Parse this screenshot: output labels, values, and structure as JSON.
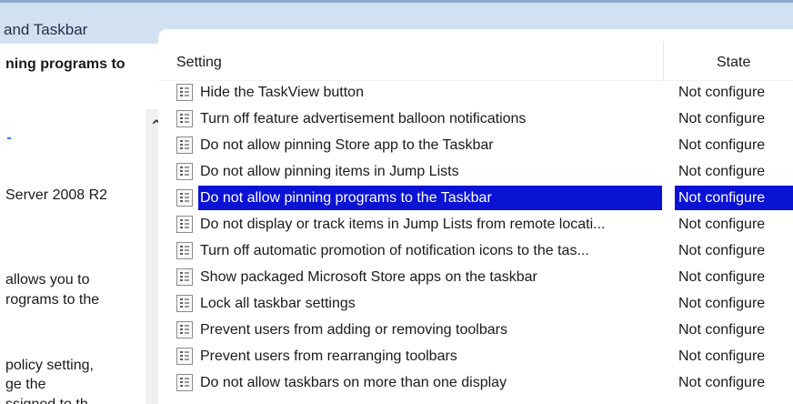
{
  "window": {
    "title": "and Taskbar"
  },
  "left_panel": {
    "heading": "ning programs to",
    "requirements": "Server 2008 R2",
    "description_lines": [
      "allows you to",
      "rograms to the",
      "policy setting,",
      "ge the",
      "ssigned to th"
    ]
  },
  "columns": {
    "setting": "Setting",
    "state": "State"
  },
  "rows": [
    {
      "name": "Hide the TaskView button",
      "state": "Not configure"
    },
    {
      "name": "Turn off feature advertisement balloon notifications",
      "state": "Not configure"
    },
    {
      "name": "Do not allow pinning Store app to the Taskbar",
      "state": "Not configure"
    },
    {
      "name": "Do not allow pinning items in Jump Lists",
      "state": "Not configure"
    },
    {
      "name": "Do not allow pinning programs to the Taskbar",
      "state": "Not configure",
      "selected": true
    },
    {
      "name": "Do not display or track items in Jump Lists from remote locati...",
      "state": "Not configure"
    },
    {
      "name": "Turn off automatic promotion of notification icons to the tas...",
      "state": "Not configure"
    },
    {
      "name": "Show packaged Microsoft Store apps on the taskbar",
      "state": "Not configure"
    },
    {
      "name": "Lock all taskbar settings",
      "state": "Not configure"
    },
    {
      "name": "Prevent users from adding or removing toolbars",
      "state": "Not configure"
    },
    {
      "name": "Prevent users from rearranging toolbars",
      "state": "Not configure"
    },
    {
      "name": "Do not allow taskbars on more than one display",
      "state": "Not configure"
    }
  ],
  "colors": {
    "selection": "#0a12d4",
    "header_band": "#d2e1f1"
  },
  "icons": {
    "policy": "policy-setting-icon",
    "scroll_up": "chevron-up-icon"
  }
}
